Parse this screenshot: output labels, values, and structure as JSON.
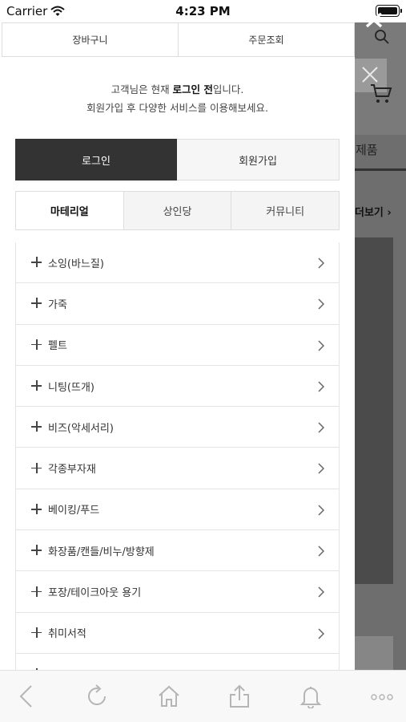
{
  "status_bar": {
    "carrier": "Carrier",
    "time": "4:23 PM"
  },
  "top_tabs": [
    "장바구니",
    "주문조회"
  ],
  "notice": {
    "line1_prefix": "고객님은 현재 ",
    "line1_bold": "로그인 전",
    "line1_suffix": "입니다.",
    "line2": "회원가입 후 다양한 서비스를 이용해보세요."
  },
  "auth": {
    "login": "로그인",
    "join": "회원가입"
  },
  "category_tabs": [
    {
      "label": "마테리얼",
      "active": true
    },
    {
      "label": "상인당",
      "active": false
    },
    {
      "label": "커뮤니티",
      "active": false
    }
  ],
  "menu_items": [
    "소잉(바느질)",
    "가죽",
    "펠트",
    "니팅(뜨개)",
    "비즈(악세서리)",
    "각종부자재",
    "베이킹/푸드",
    "화장품/캔들/비누/방향제",
    "포장/테이크아웃 용기",
    "취미서적"
  ],
  "background_page": {
    "product_label": "제품",
    "more_label": "더보기"
  },
  "icons": {
    "wifi": "wifi-icon",
    "battery": "battery-icon",
    "close": "close-icon",
    "search": "search-icon",
    "cart": "cart-icon",
    "plus": "plus-icon",
    "chevron": "chevron-right-icon",
    "back": "back-icon",
    "refresh": "refresh-icon",
    "home": "home-icon",
    "share": "share-icon",
    "bell": "bell-icon",
    "more": "more-icon"
  },
  "colors": {
    "login_bg": "#333333",
    "overlay": "#6e6e6e",
    "toolbar_icon": "#b5b5b5"
  }
}
